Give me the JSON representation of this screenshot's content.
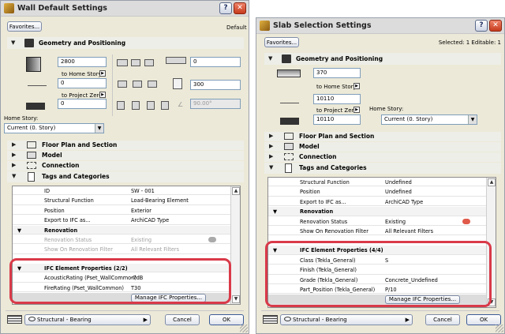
{
  "left": {
    "title": "Wall Default Settings",
    "favorites": "Favorites...",
    "mode": "Default",
    "geometry": {
      "heading": "Geometry and Positioning",
      "height": "2800",
      "to_home": "to Home Story",
      "offset": "0",
      "to_project": "to Project Zero",
      "elev": "0",
      "right_top": "0",
      "thickness": "300",
      "angle": "90.00°",
      "home_story_label": "Home Story:",
      "home_story": "Current (0. Story)"
    },
    "panels": [
      "Floor Plan and Section",
      "Model",
      "Connection",
      "Tags and Categories"
    ],
    "rows": [
      {
        "k": "ID",
        "v": "SW - 001",
        "t": "normal"
      },
      {
        "k": "Structural Function",
        "v": "Load-Bearing Element",
        "t": "normal"
      },
      {
        "k": "Position",
        "v": "Exterior",
        "t": "normal"
      },
      {
        "k": "Export to IFC as...",
        "v": "ArchiCAD Type",
        "t": "normal"
      },
      {
        "k": "Renovation",
        "v": "",
        "t": "group"
      },
      {
        "k": "Renovation Status",
        "v": "Existing",
        "t": "dim"
      },
      {
        "k": "Show On Renovation Filter",
        "v": "All Relevant Filters",
        "t": "dim"
      },
      {
        "k": "IFC Element Properties (2/2)",
        "v": "",
        "t": "group"
      },
      {
        "k": "AcousticRating (Pset_WallCommon)",
        "v": "-7dB",
        "t": "normal"
      },
      {
        "k": "FireRating (Pset_WallCommon)",
        "v": "T30",
        "t": "normal"
      }
    ],
    "manage": "Manage IFC Properties...",
    "layer": "Structural - Bearing",
    "cancel": "Cancel",
    "ok": "OK"
  },
  "right": {
    "title": "Slab Selection Settings",
    "favorites": "Favorites...",
    "selected": "Selected: 1 Editable: 1",
    "geometry": {
      "heading": "Geometry and Positioning",
      "thick": "370",
      "to_home": "to Home Story",
      "offset": "10110",
      "to_project": "to Project Zero",
      "elev": "10110",
      "home_story_label": "Home Story:",
      "home_story": "Current (0. Story)"
    },
    "panels": [
      "Floor Plan and Section",
      "Model",
      "Connection",
      "Tags and Categories"
    ],
    "rows": [
      {
        "k": "Structural Function",
        "v": "Undefined",
        "t": "normal"
      },
      {
        "k": "Position",
        "v": "Undefined",
        "t": "normal"
      },
      {
        "k": "Export to IFC as...",
        "v": "ArchiCAD Type",
        "t": "normal"
      },
      {
        "k": "Renovation",
        "v": "",
        "t": "group"
      },
      {
        "k": "Renovation Status",
        "v": "Existing",
        "t": "normal"
      },
      {
        "k": "Show On Renovation Filter",
        "v": "All Relevant Filters",
        "t": "normal"
      },
      {
        "k": "IFC Element Properties (4/4)",
        "v": "",
        "t": "group"
      },
      {
        "k": "Class (Tekla_General)",
        "v": "S",
        "t": "normal"
      },
      {
        "k": "Finish (Tekla_General)",
        "v": "",
        "t": "normal"
      },
      {
        "k": "Grade (Tekla_General)",
        "v": "Concrete_Undefined",
        "t": "normal"
      },
      {
        "k": "Part_Position (Tekla_General)",
        "v": "P/10",
        "t": "normal"
      }
    ],
    "manage": "Manage IFC Properties...",
    "layer": "Structural - Bearing",
    "cancel": "Cancel",
    "ok": "OK"
  }
}
